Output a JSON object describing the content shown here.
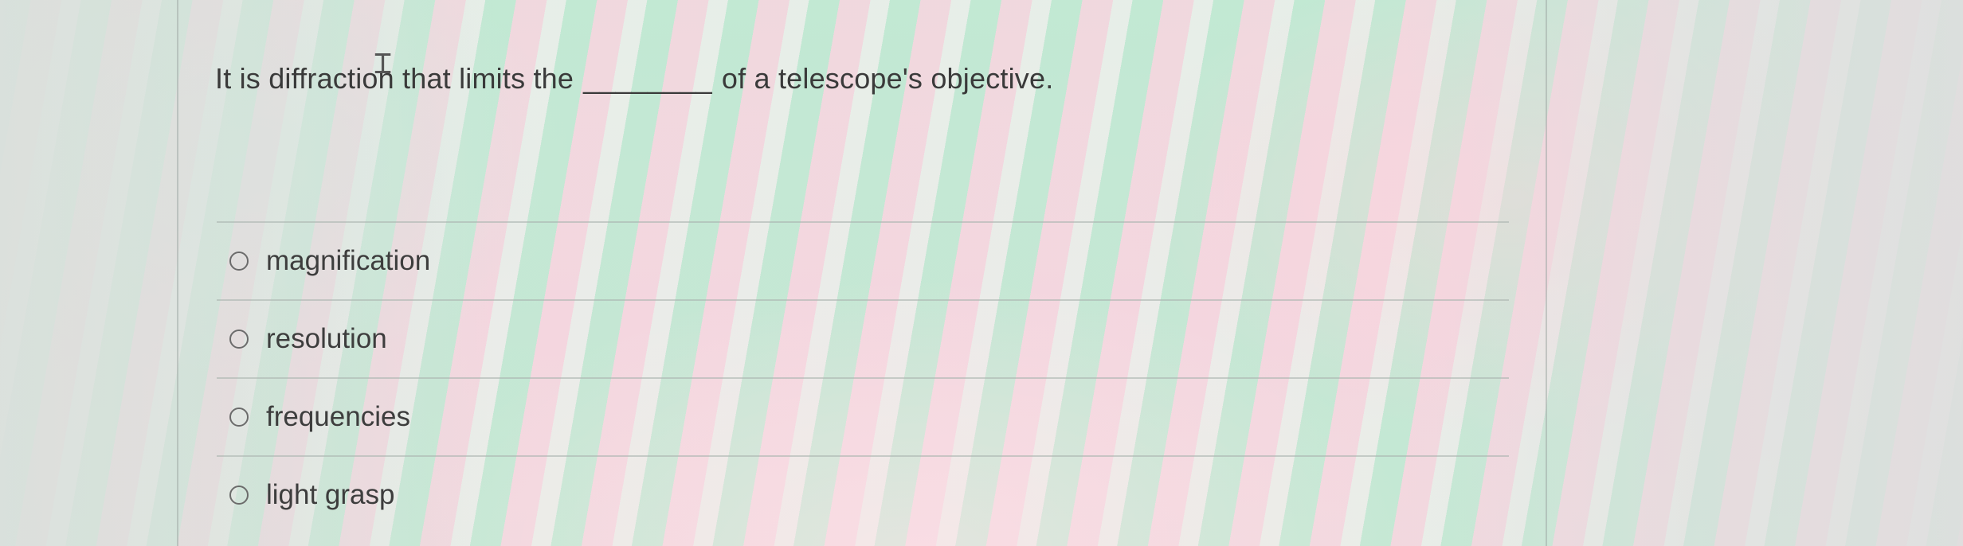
{
  "question": {
    "text_before": "It is diffraction that limits the",
    "blank": "________",
    "text_after": "of a telescope's objective."
  },
  "options": [
    {
      "label": "magnification"
    },
    {
      "label": "resolution"
    },
    {
      "label": "frequencies"
    },
    {
      "label": "light grasp"
    }
  ],
  "icons": {
    "text_cursor": "text-cursor-icon",
    "radio": "radio-unchecked-icon"
  }
}
